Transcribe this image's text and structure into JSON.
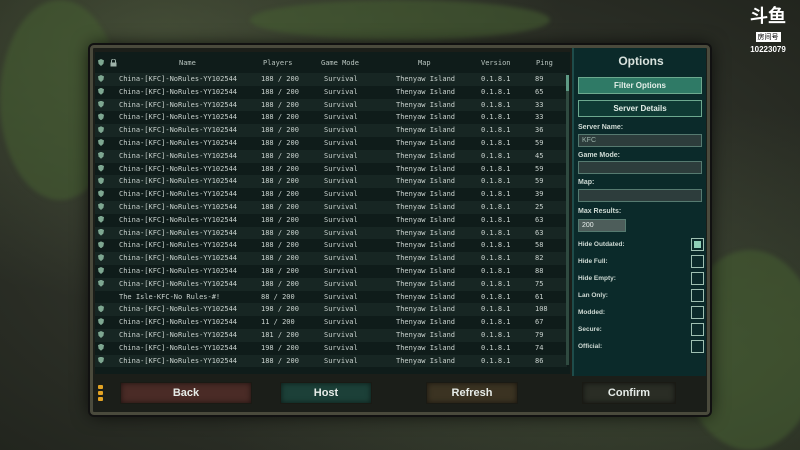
{
  "watermark": {
    "logo": "斗鱼",
    "sub": "房间号",
    "room": "10223079"
  },
  "list": {
    "headers": {
      "name": "Name",
      "players": "Players",
      "game_mode": "Game Mode",
      "map": "Map",
      "version": "Version",
      "ping": "Ping"
    },
    "rows": [
      {
        "shield": true,
        "name": "China-[KFC]-NoRules-YY102544",
        "players": "188 / 200",
        "mode": "Survival",
        "map": "Thenyaw Island",
        "version": "0.1.8.1",
        "ping": "89"
      },
      {
        "shield": true,
        "name": "China-[KFC]-NoRules-YY102544",
        "players": "188 / 200",
        "mode": "Survival",
        "map": "Thenyaw Island",
        "version": "0.1.8.1",
        "ping": "65"
      },
      {
        "shield": true,
        "name": "China-[KFC]-NoRules-YY102544",
        "players": "188 / 200",
        "mode": "Survival",
        "map": "Thenyaw Island",
        "version": "0.1.8.1",
        "ping": "33"
      },
      {
        "shield": true,
        "name": "China-[KFC]-NoRules-YY102544",
        "players": "188 / 200",
        "mode": "Survival",
        "map": "Thenyaw Island",
        "version": "0.1.8.1",
        "ping": "33"
      },
      {
        "shield": true,
        "name": "China-[KFC]-NoRules-YY102544",
        "players": "188 / 200",
        "mode": "Survival",
        "map": "Thenyaw Island",
        "version": "0.1.8.1",
        "ping": "36"
      },
      {
        "shield": true,
        "name": "China-[KFC]-NoRules-YY102544",
        "players": "188 / 200",
        "mode": "Survival",
        "map": "Thenyaw Island",
        "version": "0.1.8.1",
        "ping": "59"
      },
      {
        "shield": true,
        "name": "China-[KFC]-NoRules-YY102544",
        "players": "188 / 200",
        "mode": "Survival",
        "map": "Thenyaw Island",
        "version": "0.1.8.1",
        "ping": "45"
      },
      {
        "shield": true,
        "name": "China-[KFC]-NoRules-YY102544",
        "players": "188 / 200",
        "mode": "Survival",
        "map": "Thenyaw Island",
        "version": "0.1.8.1",
        "ping": "59"
      },
      {
        "shield": true,
        "name": "China-[KFC]-NoRules-YY102544",
        "players": "188 / 200",
        "mode": "Survival",
        "map": "Thenyaw Island",
        "version": "0.1.8.1",
        "ping": "59"
      },
      {
        "shield": true,
        "name": "China-[KFC]-NoRules-YY102544",
        "players": "188 / 200",
        "mode": "Survival",
        "map": "Thenyaw Island",
        "version": "0.1.8.1",
        "ping": "39"
      },
      {
        "shield": true,
        "name": "China-[KFC]-NoRules-YY102544",
        "players": "188 / 200",
        "mode": "Survival",
        "map": "Thenyaw Island",
        "version": "0.1.8.1",
        "ping": "25"
      },
      {
        "shield": true,
        "name": "China-[KFC]-NoRules-YY102544",
        "players": "188 / 200",
        "mode": "Survival",
        "map": "Thenyaw Island",
        "version": "0.1.8.1",
        "ping": "63"
      },
      {
        "shield": true,
        "name": "China-[KFC]-NoRules-YY102544",
        "players": "188 / 200",
        "mode": "Survival",
        "map": "Thenyaw Island",
        "version": "0.1.8.1",
        "ping": "63"
      },
      {
        "shield": true,
        "name": "China-[KFC]-NoRules-YY102544",
        "players": "188 / 200",
        "mode": "Survival",
        "map": "Thenyaw Island",
        "version": "0.1.8.1",
        "ping": "58"
      },
      {
        "shield": true,
        "name": "China-[KFC]-NoRules-YY102544",
        "players": "188 / 200",
        "mode": "Survival",
        "map": "Thenyaw Island",
        "version": "0.1.8.1",
        "ping": "82"
      },
      {
        "shield": true,
        "name": "China-[KFC]-NoRules-YY102544",
        "players": "188 / 200",
        "mode": "Survival",
        "map": "Thenyaw Island",
        "version": "0.1.8.1",
        "ping": "88"
      },
      {
        "shield": true,
        "name": "China-[KFC]-NoRules-YY102544",
        "players": "188 / 200",
        "mode": "Survival",
        "map": "Thenyaw Island",
        "version": "0.1.8.1",
        "ping": "75"
      },
      {
        "shield": false,
        "name": "The Isle-KFC-No Rules-#!",
        "players": "88 / 200",
        "mode": "Survival",
        "map": "Thenyaw Island",
        "version": "0.1.8.1",
        "ping": "61"
      },
      {
        "shield": true,
        "name": "China-[KFC]-NoRules-YY102544",
        "players": "198 / 200",
        "mode": "Survival",
        "map": "Thenyaw Island",
        "version": "0.1.8.1",
        "ping": "108"
      },
      {
        "shield": true,
        "name": "China-[KFC]-NoRules-YY102544",
        "players": "11 / 200",
        "mode": "Survival",
        "map": "Thenyaw Island",
        "version": "0.1.8.1",
        "ping": "67"
      },
      {
        "shield": true,
        "name": "China-[KFC]-NoRules-YY102544",
        "players": "181 / 200",
        "mode": "Survival",
        "map": "Thenyaw Island",
        "version": "0.1.8.1",
        "ping": "79"
      },
      {
        "shield": true,
        "name": "China-[KFC]-NoRules-YY102544",
        "players": "198 / 200",
        "mode": "Survival",
        "map": "Thenyaw Island",
        "version": "0.1.8.1",
        "ping": "74"
      },
      {
        "shield": true,
        "name": "China-[KFC]-NoRules-YY102544",
        "players": "188 / 200",
        "mode": "Survival",
        "map": "Thenyaw Island",
        "version": "0.1.8.1",
        "ping": "86"
      }
    ]
  },
  "options": {
    "title": "Options",
    "filter_btn": "Filter Options",
    "details_btn": "Server Details",
    "server_name_label": "Server Name:",
    "server_name_value": "KFC",
    "game_mode_label": "Game Mode:",
    "game_mode_value": "",
    "map_label": "Map:",
    "map_value": "",
    "max_results_label": "Max Results:",
    "max_results_value": "200",
    "checks": [
      {
        "label": "Hide Outdated:",
        "checked": true
      },
      {
        "label": "Hide Full:",
        "checked": false
      },
      {
        "label": "Hide Empty:",
        "checked": false
      },
      {
        "label": "Lan Only:",
        "checked": false
      },
      {
        "label": "Modded:",
        "checked": false
      },
      {
        "label": "Secure:",
        "checked": false
      },
      {
        "label": "Official:",
        "checked": false
      }
    ]
  },
  "buttons": {
    "back": "Back",
    "host": "Host",
    "refresh": "Refresh",
    "confirm": "Confirm"
  },
  "colors": {
    "accent": "#2f7a66",
    "panel": "#0b2a2a",
    "list_bg": "#0f1c1a",
    "led": "#e3a324"
  }
}
